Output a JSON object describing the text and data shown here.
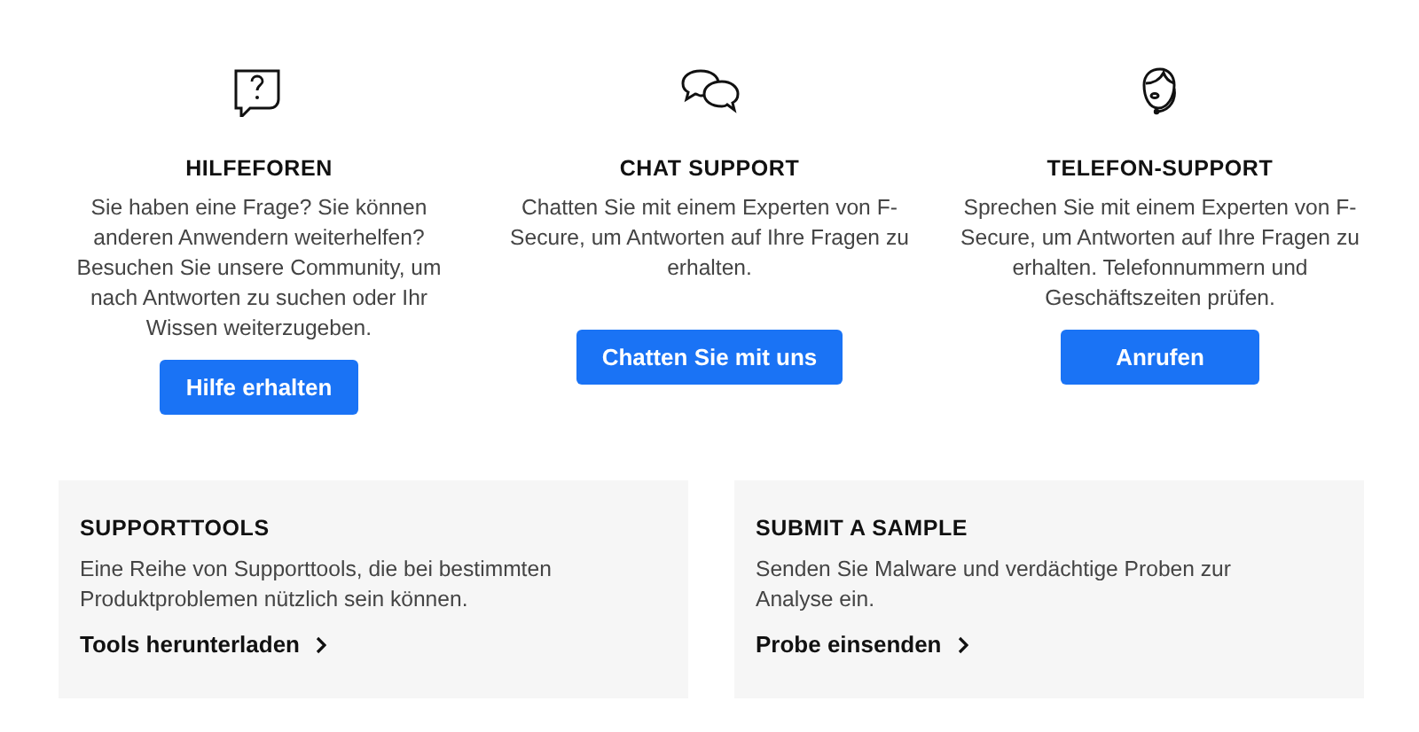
{
  "options": [
    {
      "kind": "forum",
      "title": "HILFEFOREN",
      "text": "Sie haben eine Frage? Sie können anderen Anwendern weiterhelfen? Besuchen Sie unsere Community, um nach Antworten zu suchen oder Ihr Wissen weiterzugeben.",
      "button": "Hilfe erhalten"
    },
    {
      "kind": "chat",
      "title": "CHAT SUPPORT",
      "text": "Chatten Sie mit einem Experten von F-Secure, um Antworten auf Ihre Fragen zu erhalten.",
      "button": "Chatten Sie mit uns"
    },
    {
      "kind": "phone",
      "title": "TELEFON-SUPPORT",
      "text": "Sprechen Sie mit einem Experten von F-Secure, um Antworten auf Ihre Fragen zu erhalten. Telefonnummern und Geschäftszeiten prüfen.",
      "button": "Anrufen"
    }
  ],
  "cards": [
    {
      "title": "SUPPORTTOOLS",
      "text": "Eine Reihe von Supporttools, die bei bestimmten Produktproblemen nützlich sein können.",
      "link": "Tools herunterladen"
    },
    {
      "title": "SUBMIT A SAMPLE",
      "text": "Senden Sie Malware und verdächtige Proben zur Analyse ein.",
      "link": "Probe einsenden"
    }
  ]
}
